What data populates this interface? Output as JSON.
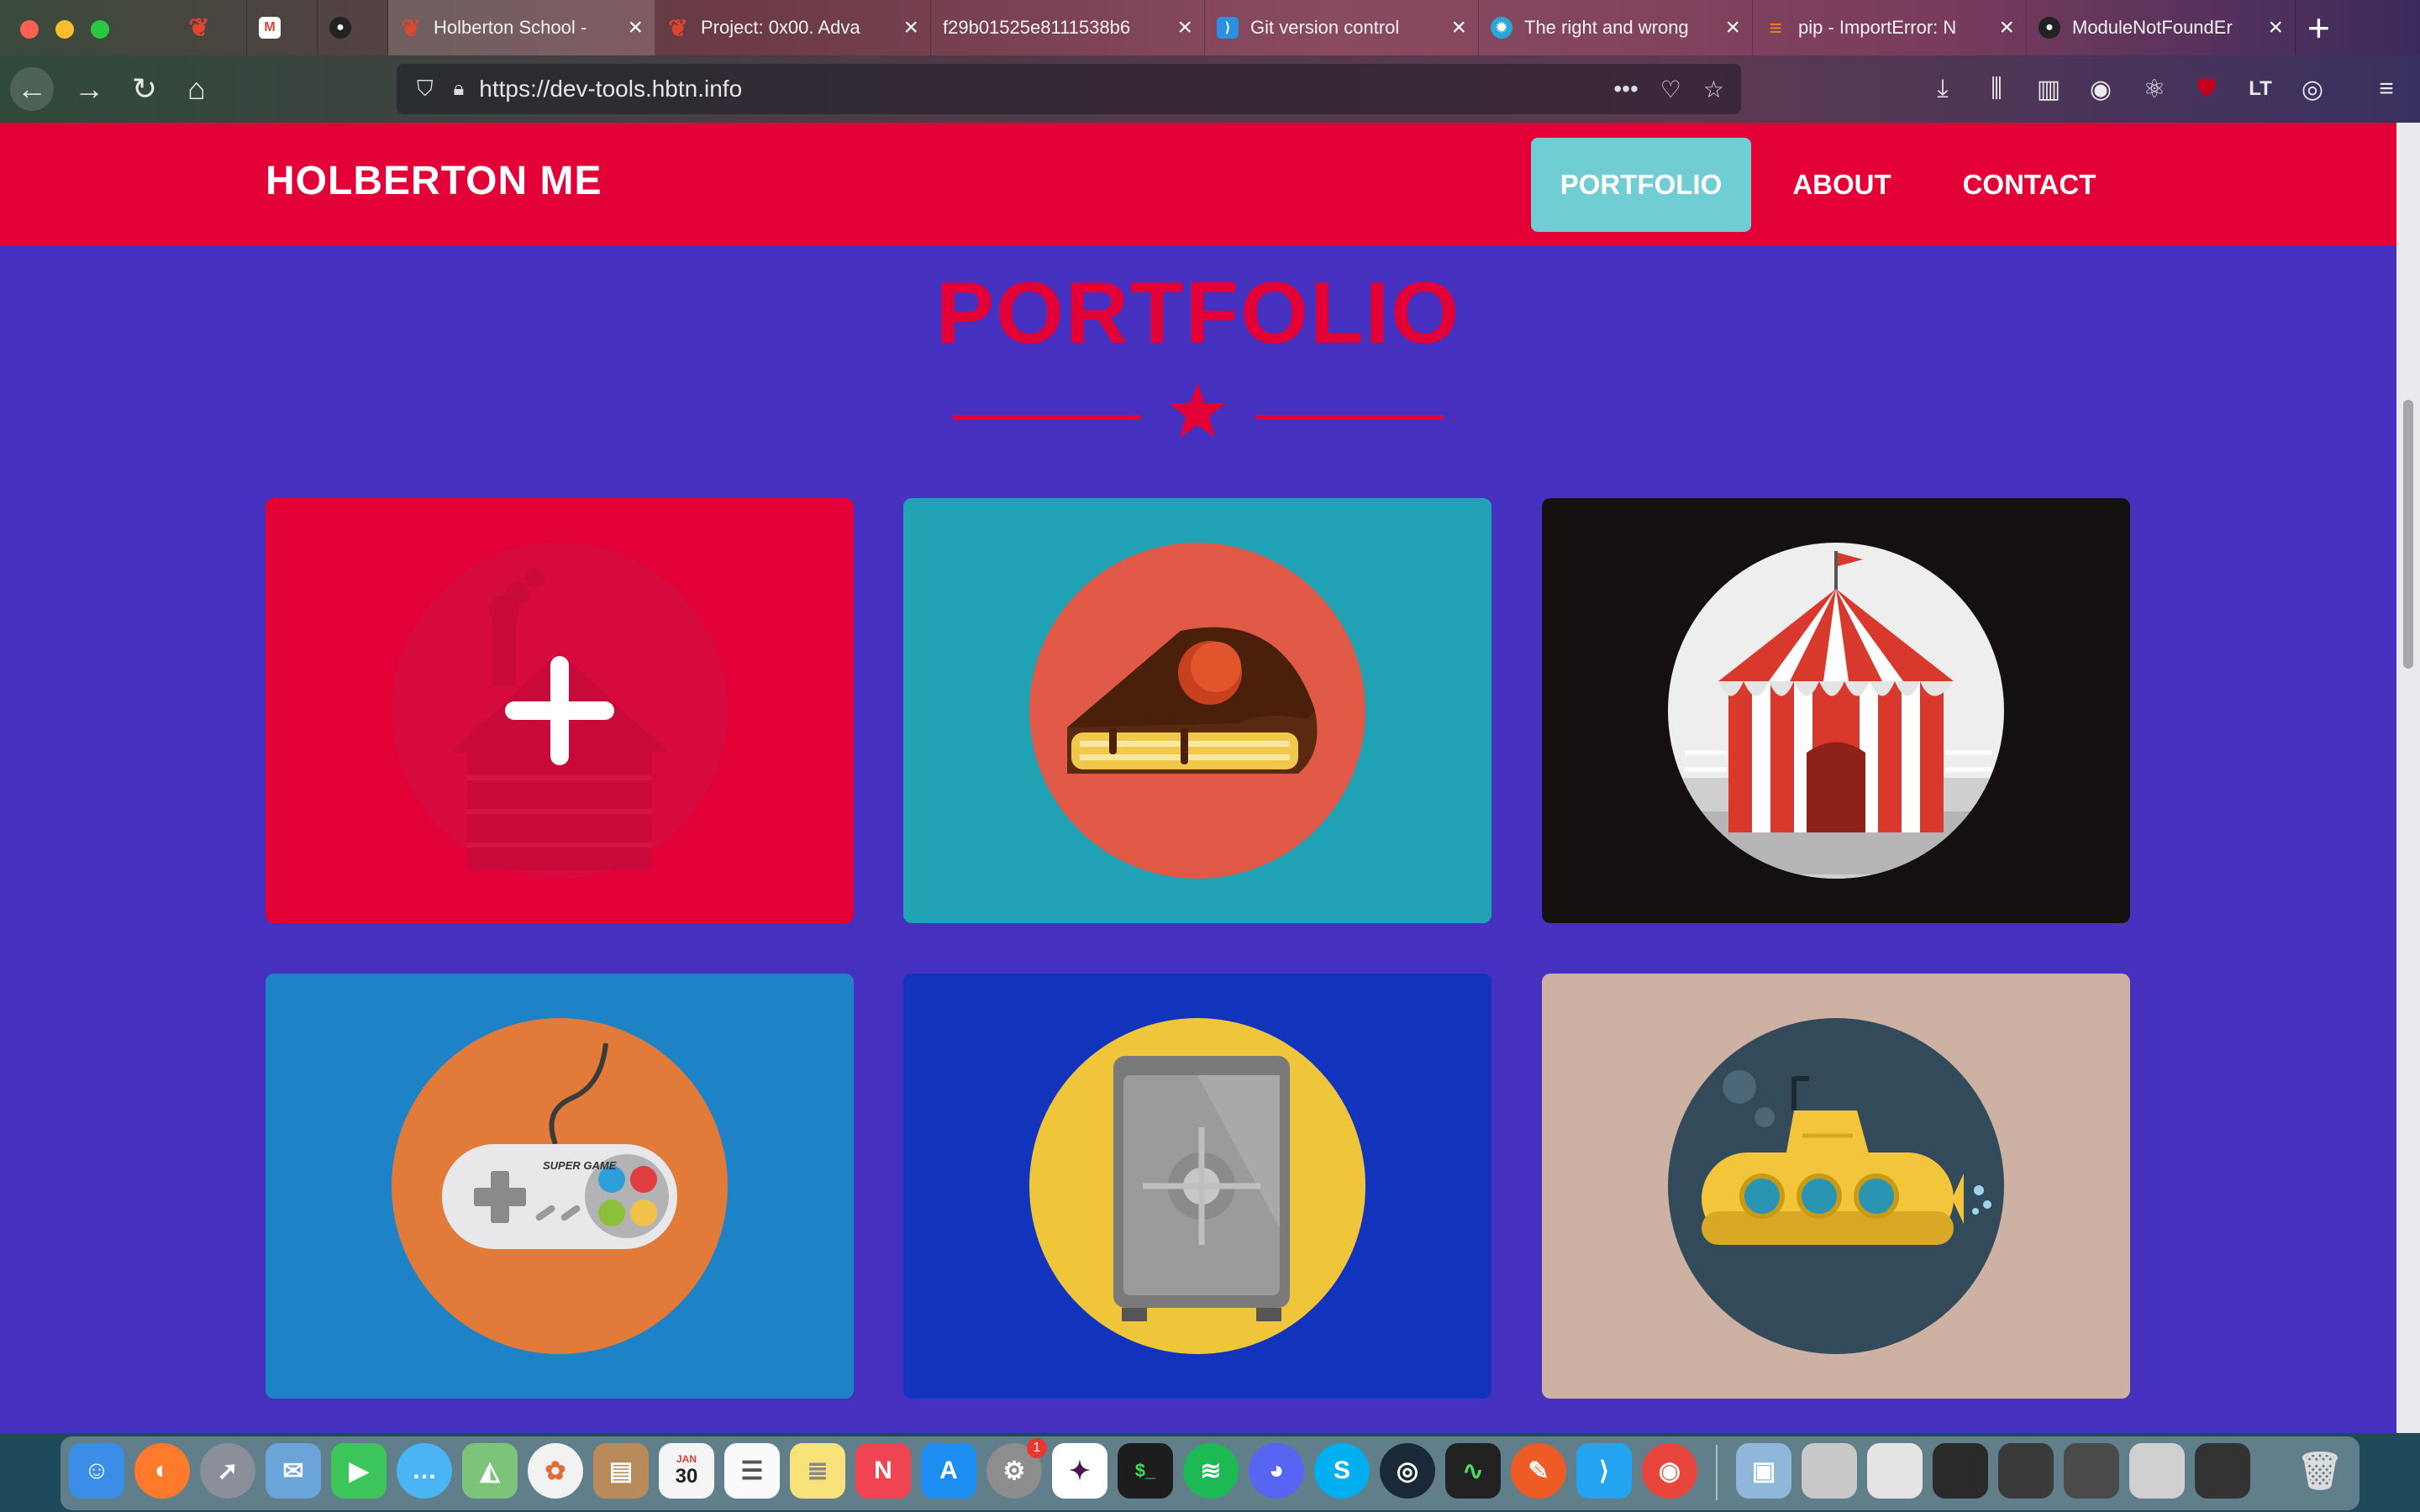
{
  "browser": {
    "tabs": [
      {
        "title": "",
        "color": "#c9452e",
        "icon": "holberton-favicon-icon"
      },
      {
        "title": "",
        "color": "#d44638",
        "icon": "gmail-icon"
      },
      {
        "title": "",
        "color": "#222222",
        "icon": "github-icon"
      },
      {
        "title": "Holberton School -",
        "color": "#c9452e",
        "icon": "holberton-favicon-icon"
      },
      {
        "title": "Project: 0x00. Adva",
        "color": "#c9452e",
        "icon": "holberton-favicon-icon"
      },
      {
        "title": "f29b01525e8111538b6",
        "color": "",
        "icon": ""
      },
      {
        "title": "Git version control",
        "color": "#2c8fe0",
        "icon": "vscode-icon"
      },
      {
        "title": "The right and wrong",
        "color": "#2aa7d6",
        "icon": "gear-icon"
      },
      {
        "title": "pip - ImportError: N",
        "color": "#f48024",
        "icon": "stackoverflow-icon"
      },
      {
        "title": "ModuleNotFoundEr",
        "color": "#222222",
        "icon": "github-icon"
      }
    ],
    "url": "https://dev-tools.hbtn.info"
  },
  "site": {
    "brand": "HOLBERTON ME",
    "nav": [
      {
        "label": "PORTFOLIO",
        "active": true
      },
      {
        "label": "ABOUT",
        "active": false
      },
      {
        "label": "CONTACT",
        "active": false
      }
    ],
    "heading": "PORTFOLIO",
    "accent": "#e20037",
    "cards": [
      {
        "bg": "#e20037",
        "circle": "#d60a3e",
        "icon": "plus-icon"
      },
      {
        "bg": "#21a3b5",
        "circle": "#e05a47",
        "icon": "cake-icon"
      },
      {
        "bg": "#141010",
        "circle": "#eeeeee",
        "icon": "circus-tent-icon"
      },
      {
        "bg": "#1e82c6",
        "circle": "#e27a3a",
        "icon": "game-controller-icon"
      },
      {
        "bg": "#1233bc",
        "circle": "#efc53a",
        "icon": "safe-icon"
      },
      {
        "bg": "#cdb2a3",
        "circle": "#324a5a",
        "icon": "submarine-icon"
      }
    ],
    "controller_label": "SUPER GAME"
  },
  "dock": {
    "calendar_month": "JAN",
    "calendar_day": "30",
    "badge": "1"
  }
}
